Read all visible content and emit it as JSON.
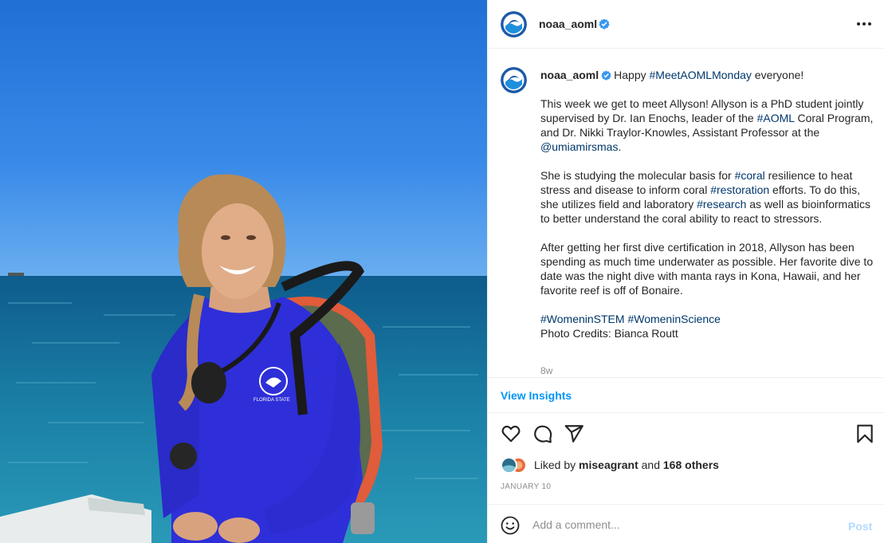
{
  "account": {
    "username": "noaa_aoml"
  },
  "photo": {
    "shirt_logo_text": "FLORIDA STATE"
  },
  "caption": {
    "username": "noaa_aoml",
    "line1_pre": "Happy ",
    "line1_tag": "#MeetAOMLMonday",
    "line1_post": " everyone!",
    "p2_a": "This week we get to meet Allyson! Allyson is a PhD student jointly supervised by Dr. Ian Enochs, leader of the ",
    "p2_tag": "#AOML",
    "p2_b": " Coral Program, and Dr. Nikki Traylor-Knowles, Assistant Professor at the ",
    "p2_mention": "@umiamirsmas",
    "p2_c": ".",
    "p3_a": "She is studying the molecular basis for ",
    "p3_tag1": "#coral",
    "p3_b": " resilience to heat stress and disease to inform coral ",
    "p3_tag2": "#restoration",
    "p3_c": " efforts. To do this, she utilizes field and laboratory ",
    "p3_tag3": "#research",
    "p3_d": " as well as bioinformatics to better understand the coral ability to react to stressors.",
    "p4": "After getting her first dive certification in 2018, Allyson has been spending as much time underwater as possible. Her favorite dive to date was the night dive with manta rays in Kona, Hawaii, and her favorite reef is off of Bonaire.",
    "p5_tag1": "#WomeninSTEM",
    "p5_tag2": "#WomeninScience",
    "p5_credit": "Photo Credits: Bianca Routt",
    "time": "8w"
  },
  "insights": {
    "label": "View Insights"
  },
  "actions": {
    "like_icon": "heart-icon",
    "comment_icon": "comment-icon",
    "share_icon": "share-icon",
    "save_icon": "bookmark-icon"
  },
  "likes": {
    "prefix": "Liked by ",
    "user": "miseagrant",
    "middle": " and ",
    "others": "168 others"
  },
  "date": "JANUARY 10",
  "comment": {
    "placeholder": "Add a comment...",
    "post_label": "Post"
  },
  "colors": {
    "link": "#00376b",
    "accent": "#0095f6",
    "post_disabled": "#b3dbff",
    "verified": "#3897f0"
  }
}
